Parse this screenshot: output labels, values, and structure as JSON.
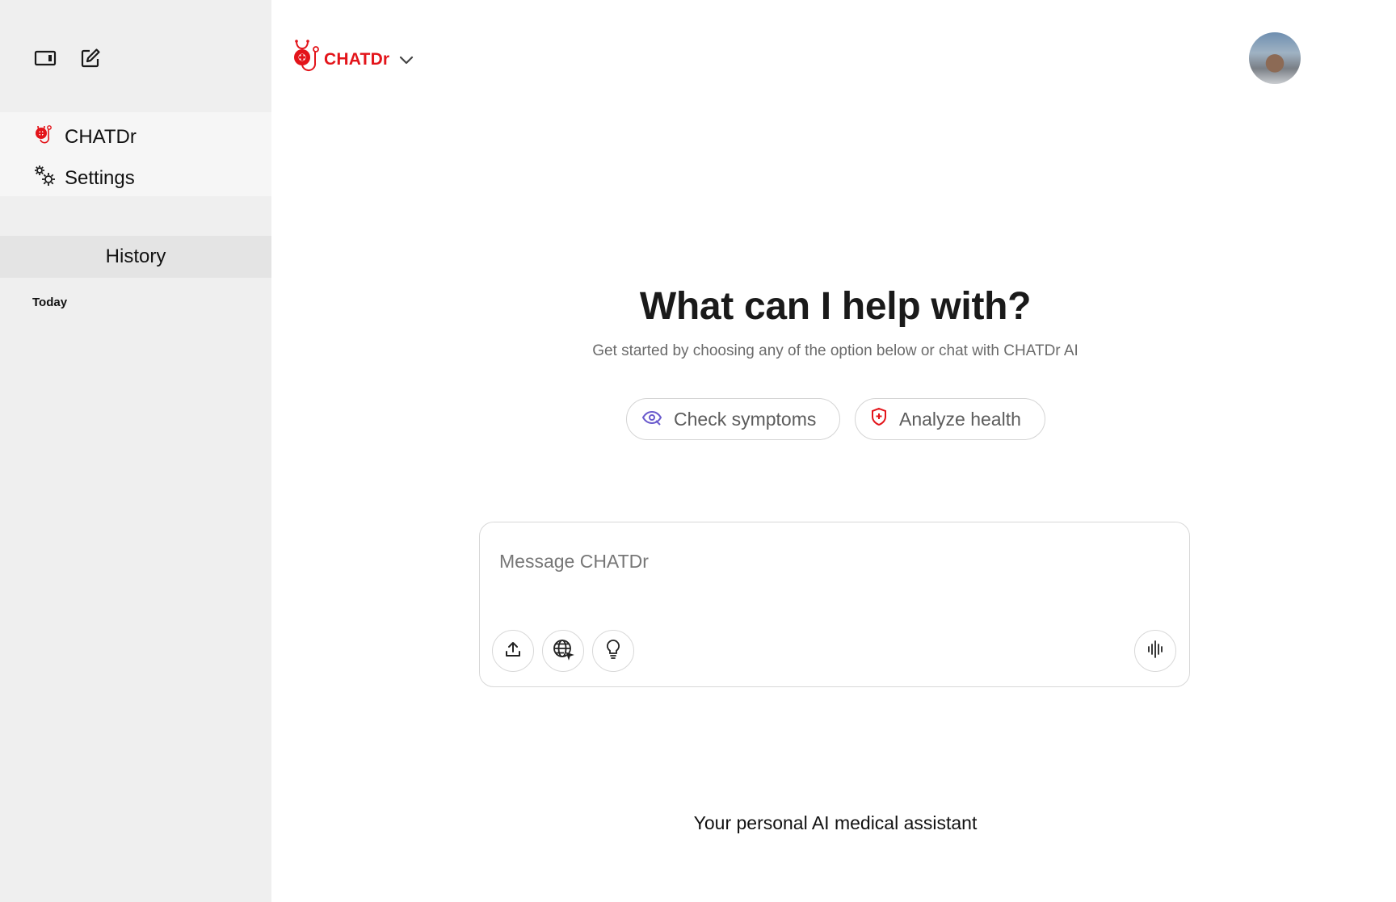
{
  "sidebar": {
    "nav": [
      {
        "label": "CHATDr",
        "icon": "chatdr-logo-icon"
      },
      {
        "label": "Settings",
        "icon": "gears-icon"
      }
    ],
    "history_label": "History",
    "groups": [
      {
        "label": "Today"
      }
    ]
  },
  "header": {
    "brand": "CHATDr",
    "brand_color": "#e3141a"
  },
  "main": {
    "title": "What can I help with?",
    "subtitle": "Get started by choosing any of the option below or chat with CHATDr AI",
    "chips": [
      {
        "label": "Check symptoms",
        "icon": "eye-icon",
        "icon_color": "#6a5acd"
      },
      {
        "label": "Analyze health",
        "icon": "shield-plus-icon",
        "icon_color": "#e3141a"
      }
    ],
    "composer": {
      "placeholder": "Message CHATDr",
      "value": ""
    },
    "tagline": "Your personal AI medical assistant"
  }
}
